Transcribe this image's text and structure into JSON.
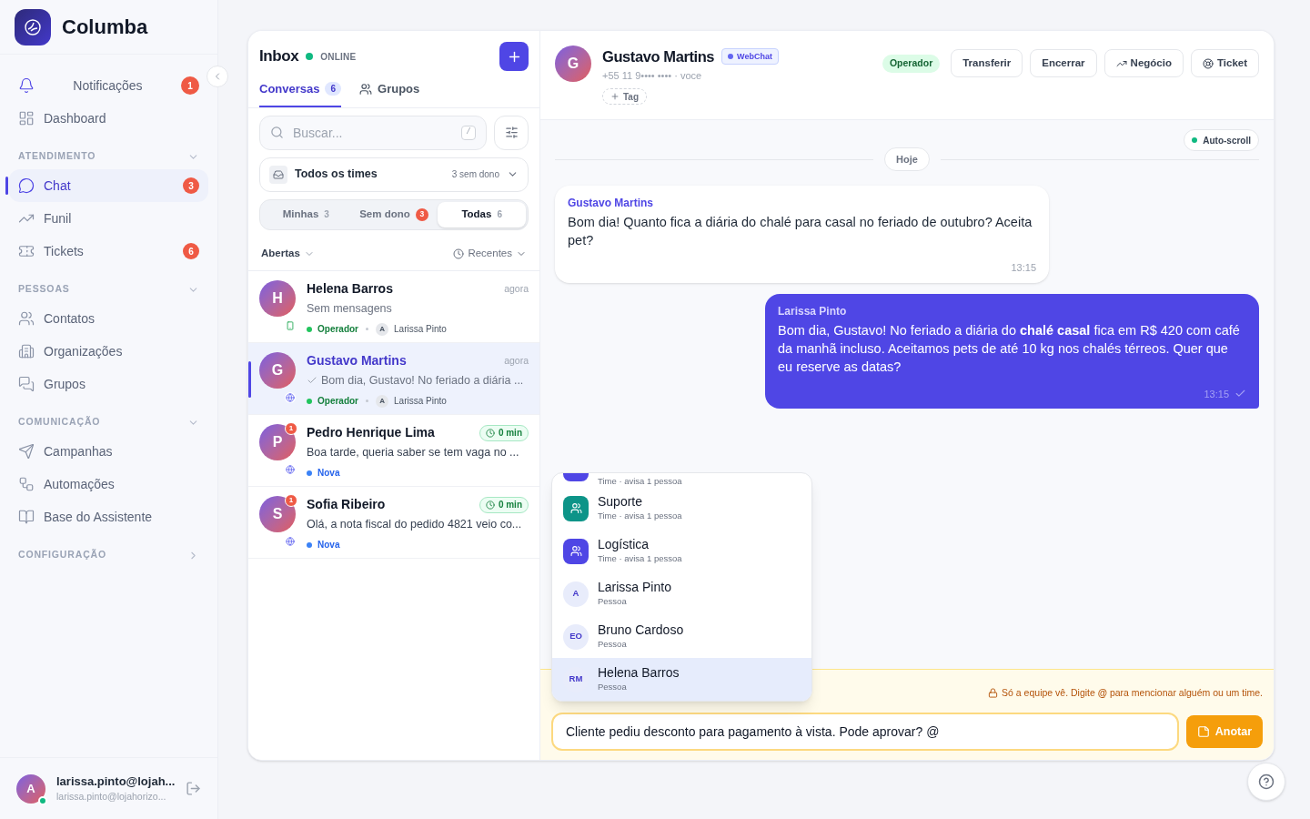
{
  "sidebar": {
    "brand": "Columba",
    "notifications": {
      "label": "Notificações",
      "badge": "1"
    },
    "top_items": [
      {
        "label": "Dashboard",
        "selected": false
      }
    ],
    "sections": [
      {
        "title": "ATENDIMENTO",
        "expanded": true,
        "items": [
          {
            "label": "Chat",
            "badge": "3",
            "selected": true
          },
          {
            "label": "Funil",
            "selected": false
          },
          {
            "label": "Tickets",
            "badge": "6",
            "selected": false
          }
        ]
      },
      {
        "title": "PESSOAS",
        "expanded": true,
        "items": [
          {
            "label": "Contatos",
            "selected": false
          },
          {
            "label": "Organizações",
            "selected": false
          },
          {
            "label": "Grupos",
            "selected": false
          }
        ]
      },
      {
        "title": "COMUNICAÇÃO",
        "expanded": true,
        "items": [
          {
            "label": "Campanhas",
            "selected": false
          },
          {
            "label": "Automações",
            "selected": false
          },
          {
            "label": "Base do Assistente",
            "selected": false
          }
        ]
      },
      {
        "title": "CONFIGURAÇÃO",
        "expanded": false
      }
    ],
    "user": {
      "initial": "A",
      "name": "larissa.pinto@lojah...",
      "email": "larissa.pinto@lojahorizo...",
      "online": true
    }
  },
  "inbox": {
    "title": "Inbox",
    "status": "ONLINE",
    "tabs": [
      {
        "label": "Conversas",
        "count": "6",
        "selected": true
      },
      {
        "label": "Grupos",
        "selected": false
      }
    ],
    "search": {
      "placeholder": "Buscar...",
      "shortcut": "/"
    },
    "team_filter": {
      "label": "Todos os times",
      "note": "3 sem dono"
    },
    "segments": [
      {
        "label": "Minhas",
        "count": "3",
        "alert": false,
        "selected": false
      },
      {
        "label": "Sem dono",
        "count": "3",
        "alert": true,
        "selected": false
      },
      {
        "label": "Todas",
        "count": "6",
        "alert": false,
        "selected": true
      }
    ],
    "status_filter": "Abertas",
    "sort": "Recentes",
    "conversations": [
      {
        "initial": "H",
        "name": "Helena Barros",
        "time": "agora",
        "preview": "Sem mensagens",
        "delivered": false,
        "kind": "whatsapp",
        "status": {
          "label": "Operador",
          "color": "#22c55e"
        },
        "agent": {
          "initial": "A",
          "name": "Larissa Pinto"
        },
        "selected": false
      },
      {
        "initial": "G",
        "name": "Gustavo Martins",
        "time": "agora",
        "preview": "Bom dia, Gustavo! No feriado a diária ...",
        "delivered": true,
        "kind": "web",
        "status": {
          "label": "Operador",
          "color": "#22c55e"
        },
        "agent": {
          "initial": "A",
          "name": "Larissa Pinto"
        },
        "selected": true
      },
      {
        "initial": "P",
        "name": "Pedro Henrique Lima",
        "unread": "1",
        "wait": "0 min",
        "preview": "Boa tarde, queria saber se tem vaga no ...",
        "delivered": false,
        "kind": "web",
        "status": {
          "label": "Nova",
          "color": "#3b82f6"
        },
        "selected": false
      },
      {
        "initial": "S",
        "name": "Sofia Ribeiro",
        "unread": "1",
        "wait": "0 min",
        "preview": "Olá, a nota fiscal do pedido 4821 veio co...",
        "delivered": false,
        "kind": "web",
        "status": {
          "label": "Nova",
          "color": "#3b82f6"
        },
        "selected": false
      }
    ]
  },
  "chat": {
    "contact": {
      "initial": "G",
      "name": "Gustavo Martins",
      "channel": "WebChat",
      "phone": "+55 11 9•••• •••• · voce",
      "add_tag": "Tag"
    },
    "status_badge": "Operador",
    "actions": [
      "Transferir",
      "Encerrar",
      "Negócio",
      "Ticket"
    ],
    "auto_scroll": {
      "label": "Auto-scroll",
      "on": true
    },
    "day": "Hoje",
    "messages": [
      {
        "outgoing": false,
        "author": "Gustavo Martins",
        "text": "Bom dia! Quanto fica a diária do chalé para casal no feriado de outubro? Aceita pet?",
        "time": "13:15",
        "delivered": false
      },
      {
        "outgoing": true,
        "author": "Larissa Pinto",
        "text": "Bom dia, Gustavo! No feriado a diária do **chalé casal** fica em R$ 420 com café da manhã incluso. Aceitamos pets de até 10 kg nos chalés térreos. Quer que eu reserve as datas?",
        "time": "13:15",
        "delivered": true
      }
    ],
    "mentions": [
      {
        "kind": "partial",
        "subtitle": "Time · avisa 1 pessoa",
        "color": "#4f46e5"
      },
      {
        "kind": "team",
        "name": "Suporte",
        "subtitle": "Time · avisa 1 pessoa",
        "color": "#0d9488",
        "selected": false
      },
      {
        "kind": "team",
        "name": "Logística",
        "subtitle": "Time · avisa 1 pessoa",
        "color": "#4f46e5",
        "selected": false
      },
      {
        "kind": "person",
        "initials": "A",
        "name": "Larissa Pinto",
        "subtitle": "Pessoa",
        "selected": false
      },
      {
        "kind": "person",
        "initials": "EO",
        "name": "Bruno Cardoso",
        "subtitle": "Pessoa",
        "selected": false
      },
      {
        "kind": "person",
        "initials": "RM",
        "name": "Helena Barros",
        "subtitle": "Pessoa",
        "selected": true
      }
    ],
    "note_hint": "Só a equipe vê. Digite **@** para mencionar alguém ou um time.",
    "composer": {
      "value": "Cliente pediu desconto para pagamento à vista. Pode aprovar? @"
    },
    "send": "Anotar"
  }
}
